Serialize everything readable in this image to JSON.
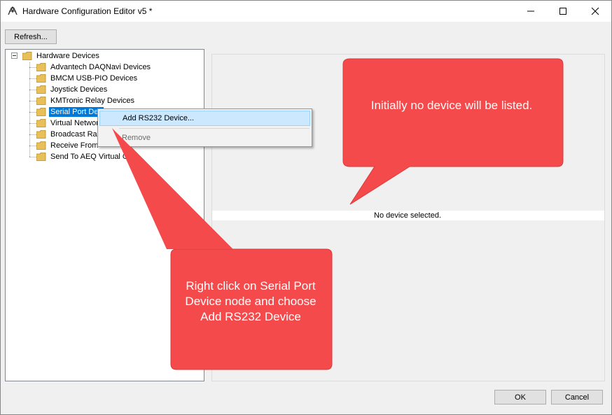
{
  "window": {
    "title": "Hardware Configuration Editor v5 *",
    "minimize_icon": "minimize-icon",
    "maximize_icon": "maximize-icon",
    "close_icon": "close-icon"
  },
  "toolbar": {
    "refresh_label": "Refresh..."
  },
  "tree": {
    "root": "Hardware Devices",
    "items": [
      "Advantech DAQNavi Devices",
      "BMCM USB-PIO Devices",
      "Joystick Devices",
      "KMTronic Relay Devices",
      "Serial Port Devices",
      "Virtual Network",
      "Broadcast Radio",
      "Receive From",
      "Send To AEQ Virtual GPIO"
    ],
    "visible_labels": [
      "Advantech DAQNavi Devices",
      "BMCM USB-PIO Devices",
      "Joystick Devices",
      "KMTronic Relay Devices",
      "Serial Port Dev",
      "Virtual Networ",
      "Broadcast Rad",
      "Receive From",
      "Send To AEQ Virtual GP"
    ],
    "selected_index": 4
  },
  "context_menu": {
    "items": [
      {
        "label": "Add RS232 Device...",
        "enabled": true
      },
      {
        "label": "Remove",
        "enabled": false
      }
    ]
  },
  "detail": {
    "empty_message": "No device selected."
  },
  "callouts": {
    "top": "Initially no device will be listed.",
    "bottom": "Right click on Serial Port Device node and choose Add RS232 Device"
  },
  "buttons": {
    "ok_label": "OK",
    "cancel_label": "Cancel"
  },
  "colors": {
    "callout": "#f54a4b",
    "selection": "#0078d7",
    "menu_hover": "#cce8ff",
    "folder": "#e8c05a"
  }
}
